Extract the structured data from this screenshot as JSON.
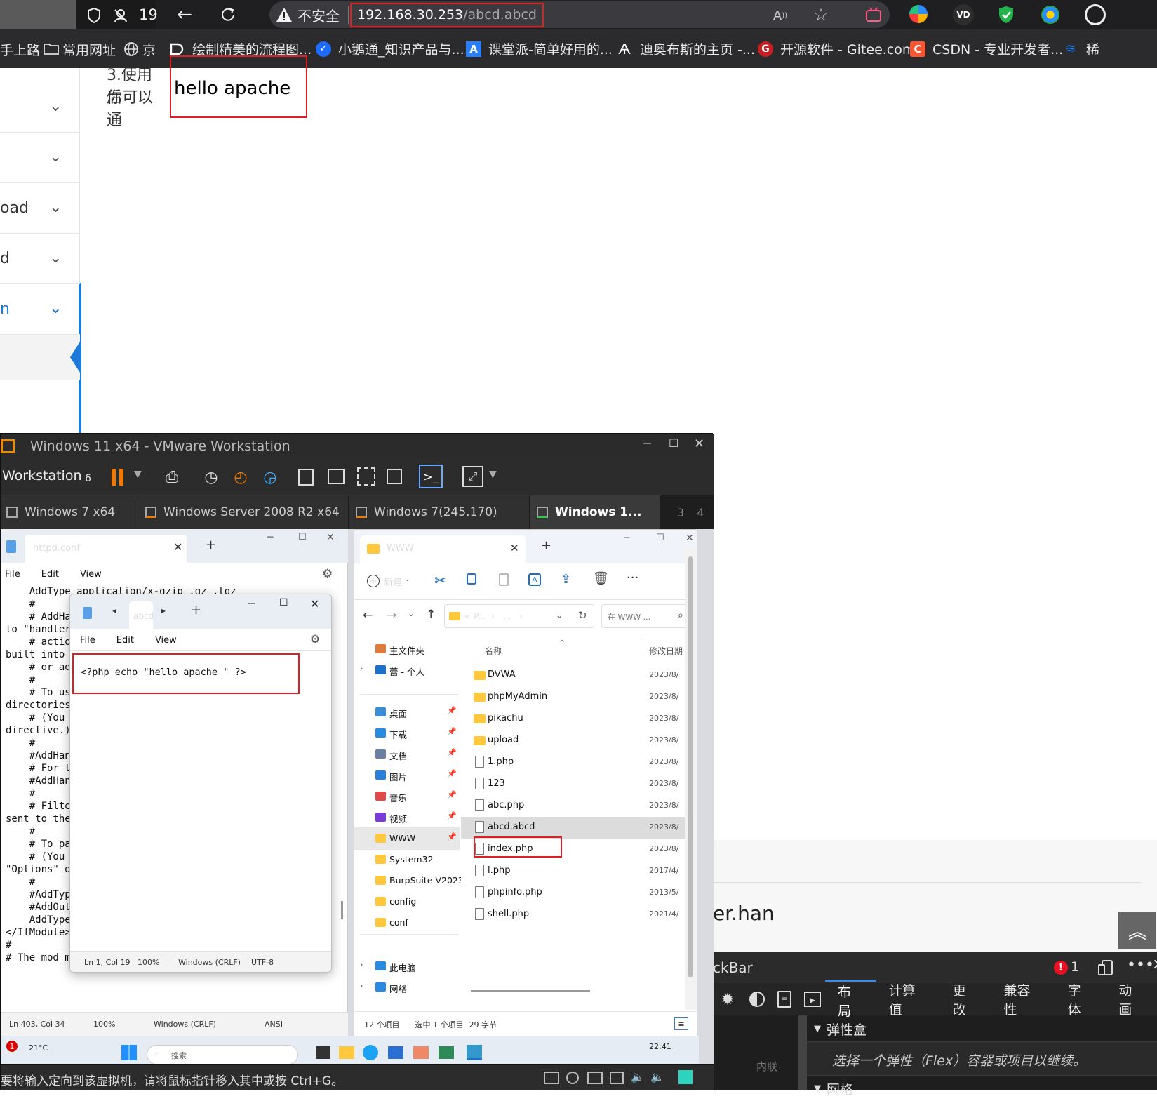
{
  "browser": {
    "left_partial_top": "19",
    "security_label": "不安全",
    "url_host": "192.168.30.253",
    "url_path": "/abcd.abcd",
    "bookmarks_left": [
      "手上路",
      "常用网址",
      "京"
    ],
    "bookmarks": [
      {
        "label": "绘制精美的流程图...",
        "icon": "flow-icon",
        "color": "#ffffff"
      },
      {
        "label": "小鹅通_知识产品与...",
        "icon": "goose-icon",
        "color": "#1e6bff"
      },
      {
        "label": "课堂派-简单好用的...",
        "icon": "ketangpai-icon",
        "color": "#2a7fff"
      },
      {
        "label": "迪奥布斯的主页 -...",
        "icon": "dio-icon",
        "color": "#ffffff"
      },
      {
        "label": "开源软件 - Gitee.com",
        "icon": "gitee-icon",
        "color": "#c71d23"
      },
      {
        "label": "CSDN - 专业开发者...",
        "icon": "csdn-icon",
        "color": "#fc5531"
      },
      {
        "label": "稀",
        "icon": "juejin-icon",
        "color": "#1e80ff"
      }
    ],
    "page_text": "hello apache"
  },
  "behind_page": {
    "heading_fragment_1": "3.使用后",
    "heading_fragment_2": "你可以通",
    "sidebar_items": [
      "",
      "",
      "oad",
      "d",
      "n",
      ""
    ],
    "bottom_text": "er.han",
    "devtools": {
      "title_fragment": "ckBar",
      "error_count": "1",
      "tabs": [
        "布局",
        "计算值",
        "更改",
        "兼容性",
        "字体",
        "动画"
      ],
      "section_flex": "弹性盒",
      "flex_hint": "选择一个弹性（Flex）容器或项目以继续。",
      "section_grid": "网格",
      "inline_label": "内联"
    }
  },
  "vmware": {
    "title": "Windows 11 x64 - VMware Workstation",
    "menu_label": "Workstation",
    "menu_num": "6",
    "tabs": [
      "Windows 7 x64",
      "Windows Server 2008 R2 x64",
      "Windows 7(245.170)",
      "Windows 1..."
    ],
    "tab_nums": [
      "3",
      "4"
    ],
    "status_hint": "要将输入定向到该虚拟机，请将鼠标指针移入其中或按 Ctrl+G。"
  },
  "notepad_back": {
    "tab": "httpd.conf",
    "menu": [
      "File",
      "Edit",
      "View"
    ],
    "lines": [
      "    AddType application/x-gzip .gz .tgz",
      "",
      "    #",
      "    # AddHar",
      "to \"handlers",
      "    # action",
      "built into t",
      "    # or add",
      "    #",
      "    # To use",
      "directories:",
      "    # (You w",
      "directive.)",
      "    #",
      "    #AddHand",
      "",
      "    # For ty",
      "    #AddHand",
      "",
      "    #",
      "    # Filter",
      "sent to the",
      "    #",
      "    # To par",
      "    # (You w",
      "\"Options\" di",
      "    #",
      "    #AddType",
      "    #AddOutp",
      "    AddType",
      "</IfModule>",
      "",
      "#",
      "# The mod_mime_magic module allows the server to use"
    ],
    "status": [
      "Ln 403, Col 34",
      "100%",
      "Windows (CRLF)",
      "ANSI"
    ]
  },
  "notepad_front": {
    "tab": "abcd",
    "menu": [
      "File",
      "Edit",
      "View"
    ],
    "code": "<?php echo \"hello apache \" ?>",
    "status": [
      "Ln 1, Col 19",
      "100%",
      "Windows (CRLF)",
      "UTF-8"
    ]
  },
  "explorer": {
    "tab": "WWW",
    "new_label": "新建",
    "breadcrumb": [
      "«",
      "P...",
      "›",
      "...",
      "›"
    ],
    "search_placeholder": "在 WWW ...",
    "col_name": "名称",
    "col_date": "修改日期",
    "sidebar": [
      {
        "label": "主文件夹",
        "icon": "home-icon"
      },
      {
        "label": "蕾 - 个人",
        "icon": "onedrive-icon"
      },
      {
        "label": "桌面",
        "icon": "desktop-icon"
      },
      {
        "label": "下载",
        "icon": "download-icon"
      },
      {
        "label": "文档",
        "icon": "document-icon"
      },
      {
        "label": "图片",
        "icon": "picture-icon"
      },
      {
        "label": "音乐",
        "icon": "music-icon"
      },
      {
        "label": "视频",
        "icon": "video-icon"
      },
      {
        "label": "WWW",
        "icon": "folder-icon"
      },
      {
        "label": "System32",
        "icon": "folder-icon"
      },
      {
        "label": "BurpSuite V2023.",
        "icon": "folder-icon"
      },
      {
        "label": "config",
        "icon": "folder-icon"
      },
      {
        "label": "conf",
        "icon": "folder-icon"
      },
      {
        "label": "此电脑",
        "icon": "pc-icon"
      },
      {
        "label": "网络",
        "icon": "network-icon"
      }
    ],
    "files": [
      {
        "name": "DVWA",
        "date": "2023/8/",
        "type": "folder"
      },
      {
        "name": "phpMyAdmin",
        "date": "2023/8/",
        "type": "folder"
      },
      {
        "name": "pikachu",
        "date": "2023/8/",
        "type": "folder"
      },
      {
        "name": "upload",
        "date": "2023/8/",
        "type": "folder"
      },
      {
        "name": "1.php",
        "date": "2023/8/",
        "type": "file"
      },
      {
        "name": "123",
        "date": "2023/8/",
        "type": "file"
      },
      {
        "name": "abc.php",
        "date": "2023/8/",
        "type": "file"
      },
      {
        "name": "abcd.abcd",
        "date": "2023/8/",
        "type": "file"
      },
      {
        "name": "index.php",
        "date": "2023/8/",
        "type": "file"
      },
      {
        "name": "l.php",
        "date": "2017/4/",
        "type": "file"
      },
      {
        "name": "phpinfo.php",
        "date": "2013/5/",
        "type": "file"
      },
      {
        "name": "shell.php",
        "date": "2021/4/",
        "type": "file"
      }
    ],
    "status_count": "12 个项目",
    "status_selected": "选中 1 个项目",
    "status_size": "29 字节"
  },
  "taskbar": {
    "temp": "21°C",
    "badge": "1",
    "time": "22:41",
    "search": "搜索"
  }
}
